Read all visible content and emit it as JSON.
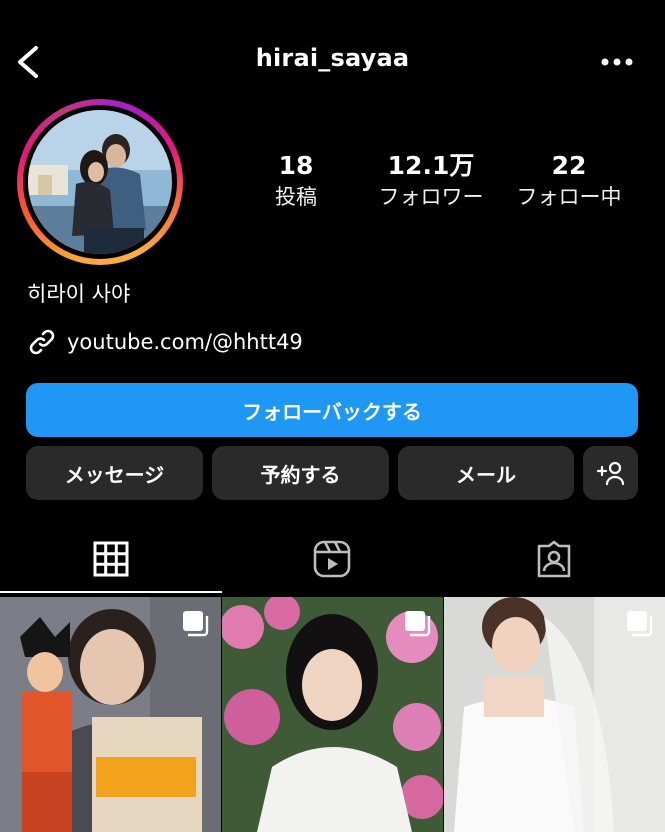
{
  "header": {
    "username": "hirai_sayaa"
  },
  "profile": {
    "name": "히라이 사야",
    "link": "youtube.com/@hhtt49",
    "stats": [
      {
        "value": "18",
        "label": "投稿"
      },
      {
        "value": "12.1万",
        "label": "フォロワー"
      },
      {
        "value": "22",
        "label": "フォロー中"
      }
    ]
  },
  "actions": {
    "follow_back": "フォローバックする",
    "message": "メッセージ",
    "reserve": "予約する",
    "email": "メール"
  },
  "tabs": [
    "grid",
    "reels",
    "tagged"
  ],
  "colors": {
    "primary_button": "#1f97f5",
    "secondary_button": "#2a2a2a",
    "background": "#000000"
  }
}
